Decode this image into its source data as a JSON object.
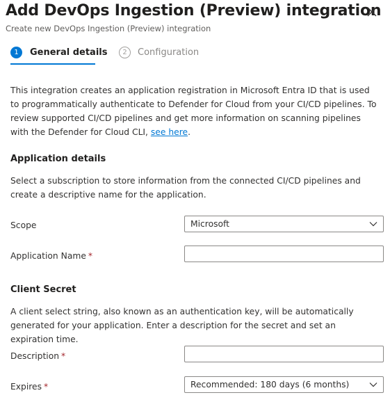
{
  "header": {
    "title": "Add DevOps Ingestion (Preview) integration",
    "subtitle": "Create new DevOps Ingestion (Preview) integration"
  },
  "steps": [
    {
      "number": "1",
      "label": "General details"
    },
    {
      "number": "2",
      "label": "Configuration"
    }
  ],
  "intro": {
    "text": "This integration creates an application registration in Microsoft Entra ID that is used to programmatically authenticate to Defender for Cloud from your CI/CD pipelines. To review supported CI/CD pipelines and get more information on scanning pipelines with the Defender for Cloud CLI, ",
    "link": "see here",
    "end": "."
  },
  "application_details": {
    "title": "Application details",
    "description": "Select a subscription to store information from the connected CI/CD pipelines and create a descriptive name for the application.",
    "scope_label": "Scope",
    "scope_value": "Microsoft",
    "app_name_label": "Application Name",
    "app_name_value": "",
    "required_mark": "*"
  },
  "client_secret": {
    "title": "Client Secret",
    "description": "A client select string, also known as an authentication key, will be automatically generated for your application. Enter a description for the secret and set an expiration time.",
    "description_label": "Description",
    "description_value": "",
    "expires_label": "Expires",
    "expires_value": "Recommended: 180 days (6 months)",
    "required_mark": "*"
  },
  "colors": {
    "accent": "#0078d4",
    "required": "#a4262c",
    "border": "#8a8886"
  },
  "icons": {
    "close": "close-icon",
    "dropdown": "chevron-down-icon"
  }
}
